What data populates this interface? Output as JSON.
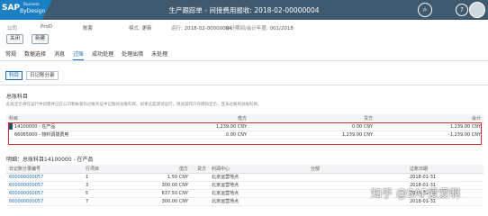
{
  "header": {
    "logo_main": "SAP",
    "logo_sub": "ByDesign",
    "logo_super": "Business",
    "title": "生产跟踪单 - 间接费用报收: 2018-02-00000004",
    "help_icon": "help-icon",
    "search_icon": "search-icon"
  },
  "meta": {
    "company_label": "公司",
    "company_value": "ProD",
    "accounts_label": "账套",
    "mode_label": "模式:",
    "mode_value": "更新",
    "run_label": "运行:",
    "run_value": "2018-02-00000004",
    "period_label": "会计期间/会计年度:",
    "period_value": "001/2018"
  },
  "buttons": {
    "close": "关闭",
    "new": "新建"
  },
  "tabs": [
    "常规",
    "数据选择",
    "消息",
    "过账",
    "成功处理",
    "处理出错",
    "未处理"
  ],
  "active_tab": "过账",
  "subtabs": [
    "科目",
    "日记账分录"
  ],
  "gl_section": {
    "title": "总账科目",
    "hint": "此处显示将在运行中创建并已在公司和帐套的过账凭证中记账的总账科目。如果这是测试运行，则此操作只有模拟显示，且未过账到总账科目。",
    "columns": [
      "科目",
      "借方",
      "贷方",
      "会计"
    ],
    "rows": [
      {
        "account": "14100000 - 在产品",
        "debit": "1,239.00 CNY",
        "credit": "0.00 CNY",
        "amount": "1,239.00 CNY"
      },
      {
        "account": "66065000 - 物料调拨费用",
        "debit": "0.00 CNY",
        "credit": "1,239.00 CNY",
        "amount": "-1,239.00 CNY"
      }
    ]
  },
  "detail_section": {
    "title": "明细：总账科目14100000 - 在产品",
    "columns": [
      "日记账分录编号",
      "行项目",
      "借方",
      "贷方",
      "利润中心",
      "分部",
      "过账日期"
    ],
    "rows": [
      {
        "entry": "600000000057",
        "line": "1",
        "debit": "1.50 CNY",
        "credit": "",
        "profit_center": "北京运营地点",
        "segment": "",
        "date": "2018-01-31"
      },
      {
        "entry": "600000000057",
        "line": "3",
        "debit": "300.00 CNY",
        "credit": "",
        "profit_center": "北京运营地点",
        "segment": "",
        "date": "2018-01-31"
      },
      {
        "entry": "600000000057",
        "line": "5",
        "debit": "637.50 CNY",
        "credit": "",
        "profit_center": "北京运营地点",
        "segment": "",
        "date": "2018-01-31"
      },
      {
        "entry": "600000000057",
        "line": "7",
        "debit": "300.00 CNY",
        "credit": "",
        "profit_center": "北京运营地点",
        "segment": "",
        "date": "2018-01-31"
      }
    ]
  },
  "watermark": "知乎 @SAP爱爱啊"
}
